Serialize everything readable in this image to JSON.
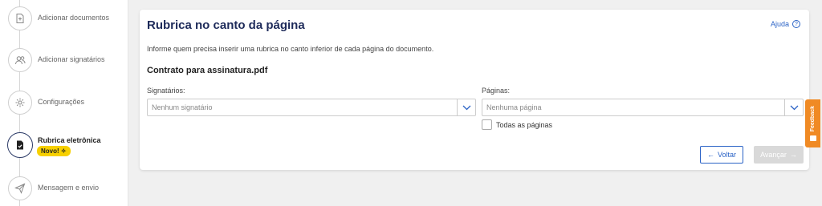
{
  "sidebar": {
    "steps": [
      {
        "label": "Adicionar documentos",
        "icon": "document-icon"
      },
      {
        "label": "Adicionar signatários",
        "icon": "users-icon"
      },
      {
        "label": "Configurações",
        "icon": "gear-icon"
      },
      {
        "label": "Rubrica eletrônica",
        "icon": "rubric-document-icon",
        "active": true,
        "badge": "Novo!"
      },
      {
        "label": "Mensagem e envio",
        "icon": "send-icon"
      }
    ]
  },
  "card": {
    "title": "Rubrica no canto da página",
    "help_label": "Ajuda",
    "description": "Informe quem precisa inserir uma rubrica no canto inferior de cada página do documento.",
    "document_name": "Contrato para assinatura.pdf"
  },
  "form": {
    "signers_label": "Signatários:",
    "signers_placeholder": "Nenhum signatário",
    "pages_label": "Páginas:",
    "pages_placeholder": "Nenhuma página",
    "all_pages_label": "Todas as páginas"
  },
  "actions": {
    "back_label": "Voltar",
    "next_label": "Avançar"
  },
  "feedback": {
    "label": "Feedback"
  },
  "colors": {
    "title": "#1e2b5a",
    "link": "#2b63c6",
    "badge": "#f7d000",
    "feedback": "#f08a24",
    "disabled_button": "#d9d9d9"
  }
}
